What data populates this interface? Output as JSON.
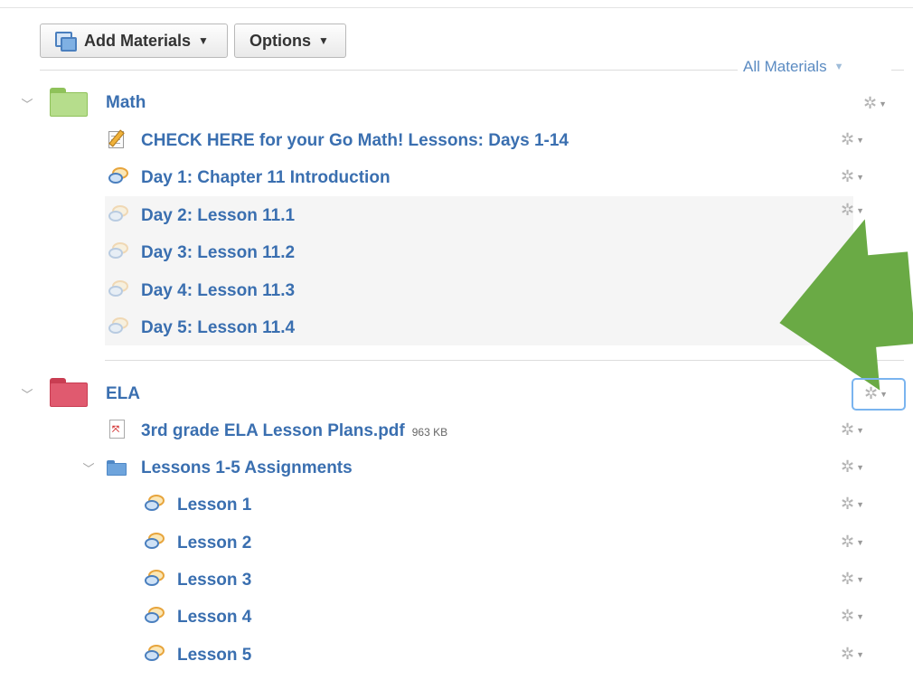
{
  "toolbar": {
    "add_materials_label": "Add Materials",
    "options_label": "Options",
    "filter_label": "All Materials"
  },
  "icons": {
    "expand": "chevron-down-icon",
    "gear": "gear-icon",
    "discussion": "discussion-bubble-icon",
    "assignment": "assignment-pencil-icon",
    "file": "pdf-file-icon",
    "folder": "folder-icon"
  },
  "colors": {
    "link": "#3a6fb0",
    "math_folder": "#b6dd8c",
    "ela_folder": "#e05a6f",
    "subfolder": "#6ea4dc",
    "arrow": "#6aaa45"
  },
  "folders": [
    {
      "name": "Math",
      "items": [
        {
          "type": "assignment",
          "title": "CHECK HERE for your Go Math! Lessons: Days 1-14"
        },
        {
          "type": "discussion",
          "title": "Day 1: Chapter 11 Introduction"
        },
        {
          "type": "discussion",
          "title": "Day 2: Lesson 11.1"
        },
        {
          "type": "discussion",
          "title": "Day 3: Lesson 11.2"
        },
        {
          "type": "discussion",
          "title": "Day 4: Lesson 11.3"
        },
        {
          "type": "discussion",
          "title": "Day 5: Lesson 11.4"
        }
      ]
    },
    {
      "name": "ELA",
      "items": [
        {
          "type": "file",
          "title": "3rd grade ELA Lesson Plans.pdf",
          "size": "963 KB"
        },
        {
          "type": "folder",
          "title": "Lessons 1-5 Assignments",
          "items": [
            {
              "type": "discussion",
              "title": "Lesson 1"
            },
            {
              "type": "discussion",
              "title": "Lesson 2"
            },
            {
              "type": "discussion",
              "title": "Lesson 3"
            },
            {
              "type": "discussion",
              "title": "Lesson 4"
            },
            {
              "type": "discussion",
              "title": "Lesson 5"
            }
          ]
        }
      ]
    }
  ]
}
